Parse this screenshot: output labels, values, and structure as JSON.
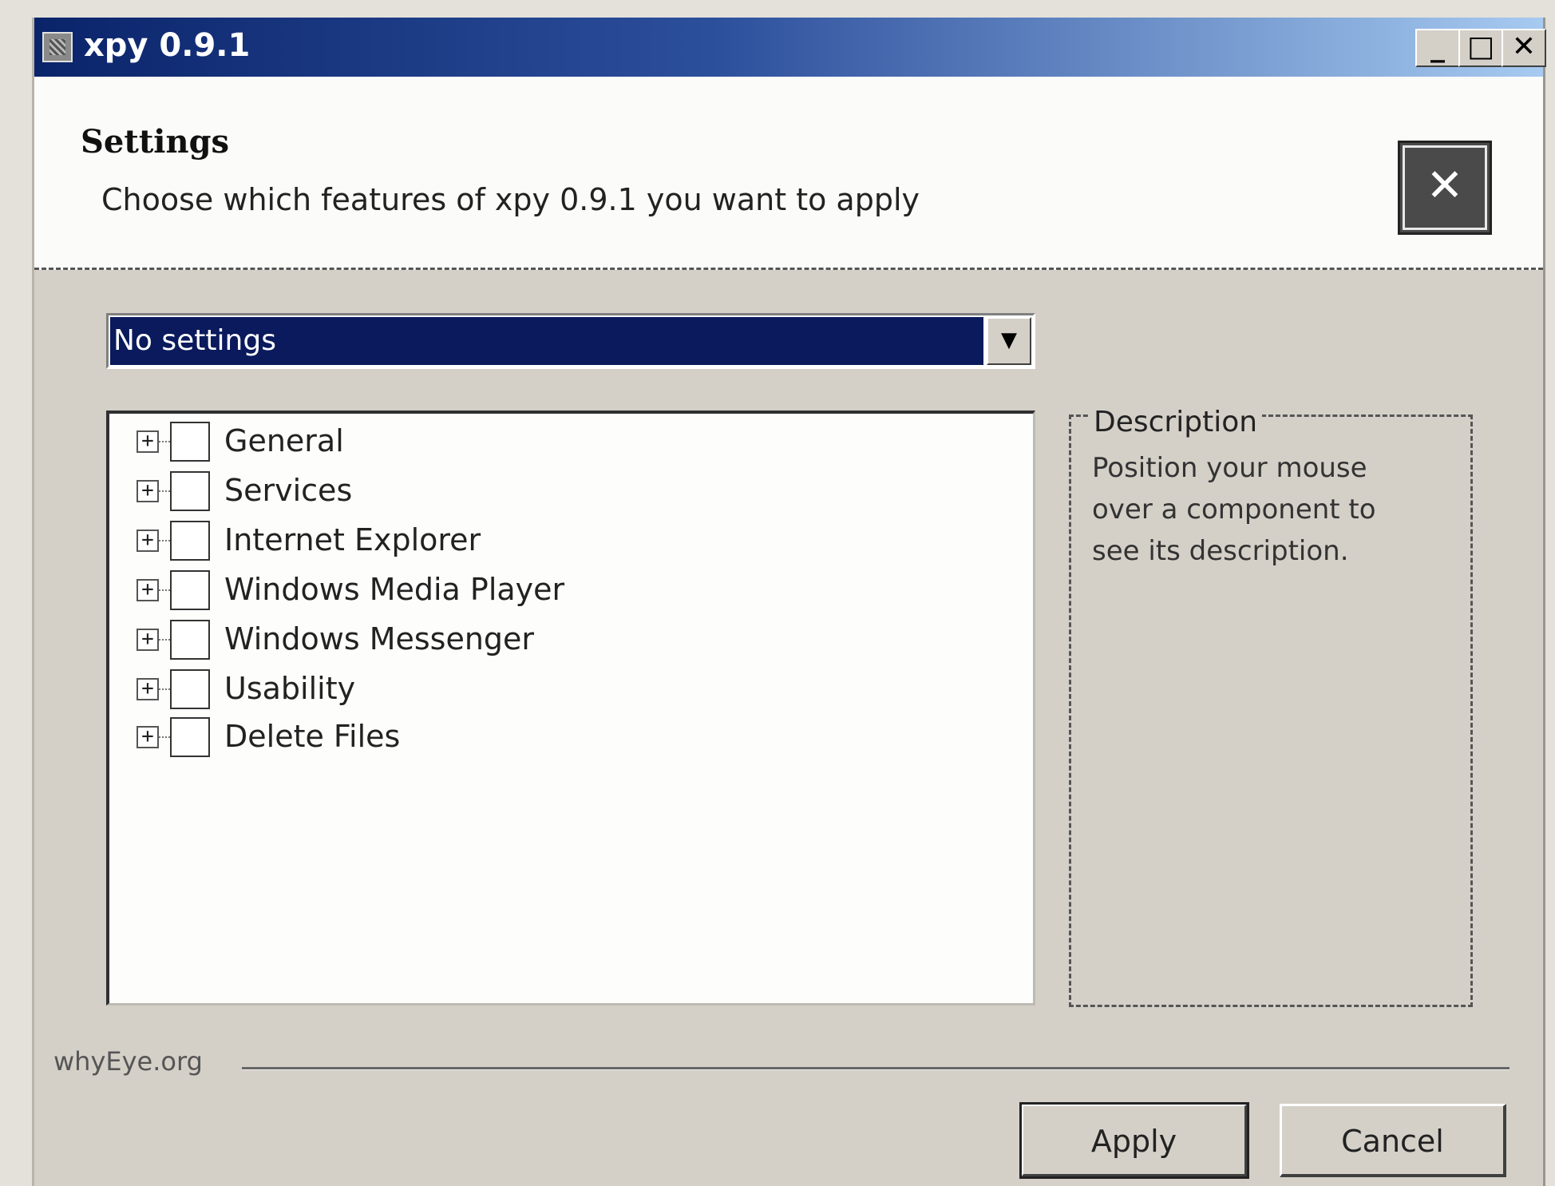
{
  "window": {
    "title": "xpy 0.9.1",
    "controls": {
      "minimize": "_",
      "maximize": "□",
      "close": "✕"
    }
  },
  "header": {
    "title": "Settings",
    "subtitle": "Choose which features of xpy 0.9.1 you want to apply"
  },
  "preset_combo": {
    "value": "No settings",
    "arrow": "▼"
  },
  "tree": {
    "items": [
      {
        "label": "General",
        "checked": false
      },
      {
        "label": "Services",
        "checked": false
      },
      {
        "label": "Internet Explorer",
        "checked": false
      },
      {
        "label": "Windows Media Player",
        "checked": false
      },
      {
        "label": "Windows Messenger",
        "checked": false
      },
      {
        "label": "Usability",
        "checked": false
      },
      {
        "label": "Delete Files",
        "checked": false
      }
    ]
  },
  "description": {
    "title": "Description",
    "text": "Position your mouse over a component to see its description."
  },
  "footer": {
    "site": "whyEye.org",
    "apply_label": "Apply",
    "cancel_label": "Cancel"
  }
}
